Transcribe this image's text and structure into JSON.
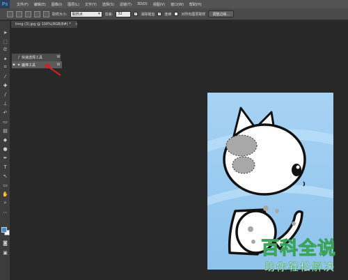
{
  "app": {
    "logo": "Ps"
  },
  "menubar": {
    "items": [
      "文件(F)",
      "编辑(E)",
      "图像(I)",
      "图层(L)",
      "文字(Y)",
      "选择(S)",
      "滤镜(T)",
      "3D(D)",
      "视图(V)",
      "窗口(W)",
      "帮助(H)"
    ]
  },
  "options": {
    "sample_size_label": "取样大小:",
    "sample_size_value": "取样点",
    "tolerance_label": "容差:",
    "tolerance_value": "32",
    "antialias_label": "消除锯齿",
    "contiguous_label": "连续",
    "all_layers_label": "对所有图层取样",
    "refine_edge_label": "调整边缘..."
  },
  "document": {
    "tab_title": "timg (3).jpg @ 100%(RGB/8#) *",
    "close_glyph": "×"
  },
  "flyout": {
    "items": [
      {
        "label": "快速选择工具",
        "shortcut": "W",
        "selected": false
      },
      {
        "label": "魔棒工具",
        "shortcut": "W",
        "selected": true
      }
    ]
  },
  "watermark": {
    "line1": "百科全说",
    "line2": "助你轻松解决"
  },
  "colors": {
    "foreground": "#3a8fd0",
    "background": "#ffffff",
    "arrow": "#d62020"
  }
}
